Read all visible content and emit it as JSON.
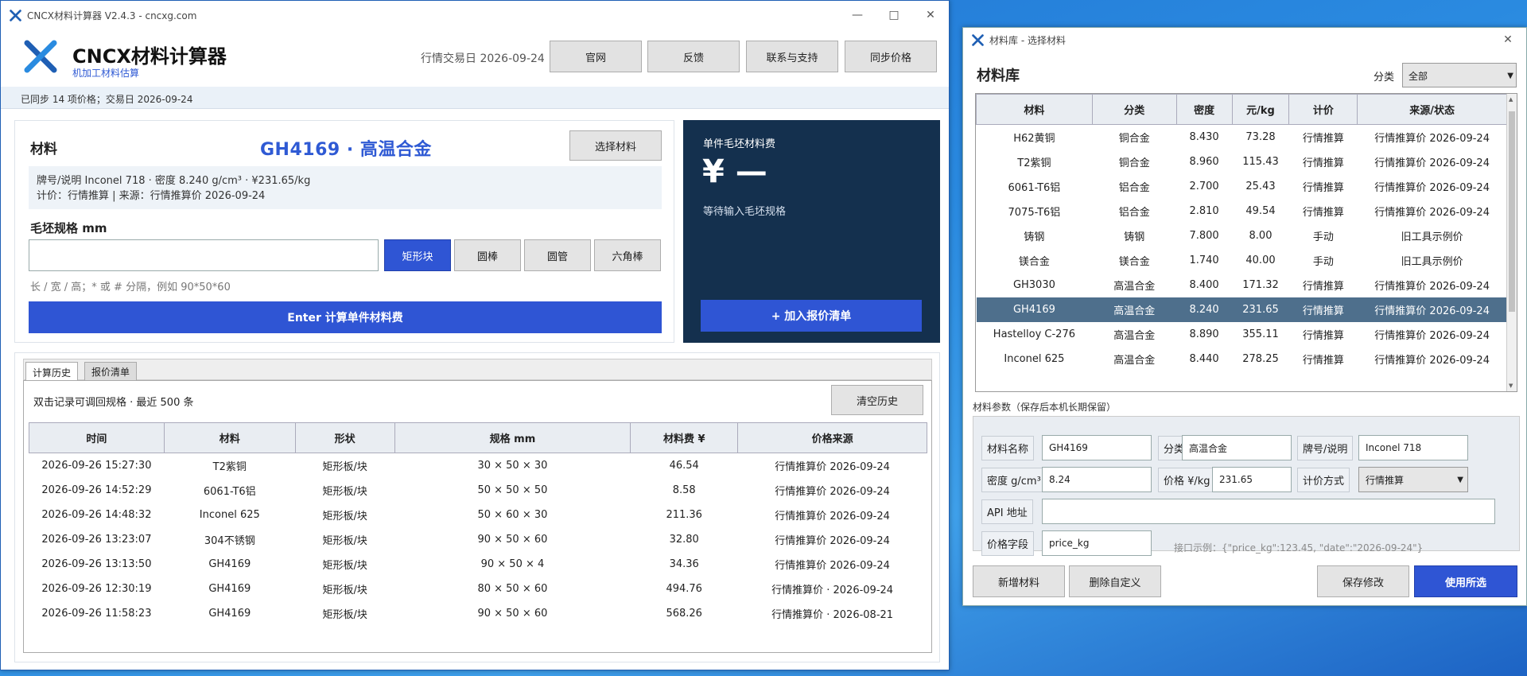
{
  "main_window": {
    "title": "CNCX材料计算器 V2.4.3 - cncxg.com",
    "app_name": "CNCX材料计算器",
    "app_subtitle": "机加工材料估算",
    "trade_date": "行情交易日 2026-09-24",
    "header_buttons": [
      "官网",
      "反馈",
      "联系与支持",
      "同步价格"
    ],
    "sync_status": "已同步 14 项价格；交易日 2026-09-24"
  },
  "material_card": {
    "label": "材料",
    "selected_name": "GH4169 · 高温合金",
    "select_button": "选择材料",
    "info_line1": "牌号/说明 Inconel 718 · 密度 8.240 g/cm³ · ¥231.65/kg",
    "info_line2": "计价：行情推算 | 来源：行情推算价 2026-09-24",
    "spec_label": "毛坯规格 mm",
    "spec_value": "",
    "shapes": [
      "矩形块",
      "圆棒",
      "圆管",
      "六角棒"
    ],
    "active_shape_index": 0,
    "hint": "长 / 宽 / 高；* 或 # 分隔，例如 90*50*60",
    "calc_button": "Enter 计算单件材料费"
  },
  "cost_card": {
    "title": "单件毛坯材料费",
    "value": "¥ —",
    "waiting": "等待输入毛坯规格",
    "add_button": "+ 加入报价清单"
  },
  "history": {
    "tabs": [
      "计算历史",
      "报价清单"
    ],
    "active_tab": 0,
    "note": "双击记录可调回规格 · 最近 500 条",
    "clear_button": "清空历史",
    "columns": [
      "时间",
      "材料",
      "形状",
      "规格 mm",
      "材料费 ¥",
      "价格来源"
    ],
    "rows": [
      [
        "2026-09-26 15:27:30",
        "T2紫铜",
        "矩形板/块",
        "30 × 50 × 30",
        "46.54",
        "行情推算价 2026-09-24"
      ],
      [
        "2026-09-26 14:52:29",
        "6061-T6铝",
        "矩形板/块",
        "50 × 50 × 50",
        "8.58",
        "行情推算价 2026-09-24"
      ],
      [
        "2026-09-26 14:48:32",
        "Inconel 625",
        "矩形板/块",
        "50 × 60 × 30",
        "211.36",
        "行情推算价 2026-09-24"
      ],
      [
        "2026-09-26 13:23:07",
        "304不锈钢",
        "矩形板/块",
        "90 × 50 × 60",
        "32.80",
        "行情推算价 2026-09-24"
      ],
      [
        "2026-09-26 13:13:50",
        "GH4169",
        "矩形板/块",
        "90 × 50 × 4",
        "34.36",
        "行情推算价 2026-09-24"
      ],
      [
        "2026-09-26 12:30:19",
        "GH4169",
        "矩形板/块",
        "80 × 50 × 60",
        "494.76",
        "行情推算价 · 2026-09-24"
      ],
      [
        "2026-09-26 11:58:23",
        "GH4169",
        "矩形板/块",
        "90 × 50 × 60",
        "568.26",
        "行情推算价 · 2026-08-21"
      ]
    ]
  },
  "library_window": {
    "title": "材料库 - 选择材料",
    "heading": "材料库",
    "category_label": "分类",
    "category_value": "全部",
    "columns": [
      "材料",
      "分类",
      "密度",
      "元/kg",
      "计价",
      "来源/状态"
    ],
    "rows": [
      [
        "H62黄铜",
        "铜合金",
        "8.430",
        "73.28",
        "行情推算",
        "行情推算价 2026-09-24"
      ],
      [
        "T2紫铜",
        "铜合金",
        "8.960",
        "115.43",
        "行情推算",
        "行情推算价 2026-09-24"
      ],
      [
        "6061-T6铝",
        "铝合金",
        "2.700",
        "25.43",
        "行情推算",
        "行情推算价 2026-09-24"
      ],
      [
        "7075-T6铝",
        "铝合金",
        "2.810",
        "49.54",
        "行情推算",
        "行情推算价 2026-09-24"
      ],
      [
        "铸钢",
        "铸钢",
        "7.800",
        "8.00",
        "手动",
        "旧工具示例价"
      ],
      [
        "镁合金",
        "镁合金",
        "1.740",
        "40.00",
        "手动",
        "旧工具示例价"
      ],
      [
        "GH3030",
        "高温合金",
        "8.400",
        "171.32",
        "行情推算",
        "行情推算价 2026-09-24"
      ],
      [
        "GH4169",
        "高温合金",
        "8.240",
        "231.65",
        "行情推算",
        "行情推算价 2026-09-24"
      ],
      [
        "Hastelloy C-276",
        "高温合金",
        "8.890",
        "355.11",
        "行情推算",
        "行情推算价 2026-09-24"
      ],
      [
        "Inconel 625",
        "高温合金",
        "8.440",
        "278.25",
        "行情推算",
        "行情推算价 2026-09-24"
      ]
    ],
    "selected_row_index": 7,
    "params_heading": "材料参数（保存后本机长期保留）",
    "params": {
      "name_label": "材料名称",
      "name_value": "GH4169",
      "category_label": "分类",
      "category_value": "高温合金",
      "grade_label": "牌号/说明",
      "grade_value": "Inconel 718",
      "density_label": "密度 g/cm³",
      "density_value": "8.24",
      "price_label": "价格 ¥/kg",
      "price_value": "231.65",
      "pricing_label": "计价方式",
      "pricing_value": "行情推算",
      "api_label": "API 地址",
      "api_value": "",
      "field_label": "价格字段",
      "field_value": "price_kg",
      "api_hint": "接口示例：{\"price_kg\":123.45, \"date\":\"2026-09-24\"}"
    },
    "buttons": {
      "add": "新增材料",
      "delete": "删除自定义",
      "save": "保存修改",
      "use": "使用所选"
    }
  },
  "colors": {
    "accent": "#2f55d4",
    "dark_card": "#14304e",
    "selected_row": "#4e6f8c",
    "desktop": "#2a8ae0"
  },
  "icons": [
    "app-logo-icon",
    "minimize-icon",
    "maximize-icon",
    "close-icon",
    "dropdown-arrow-icon"
  ]
}
